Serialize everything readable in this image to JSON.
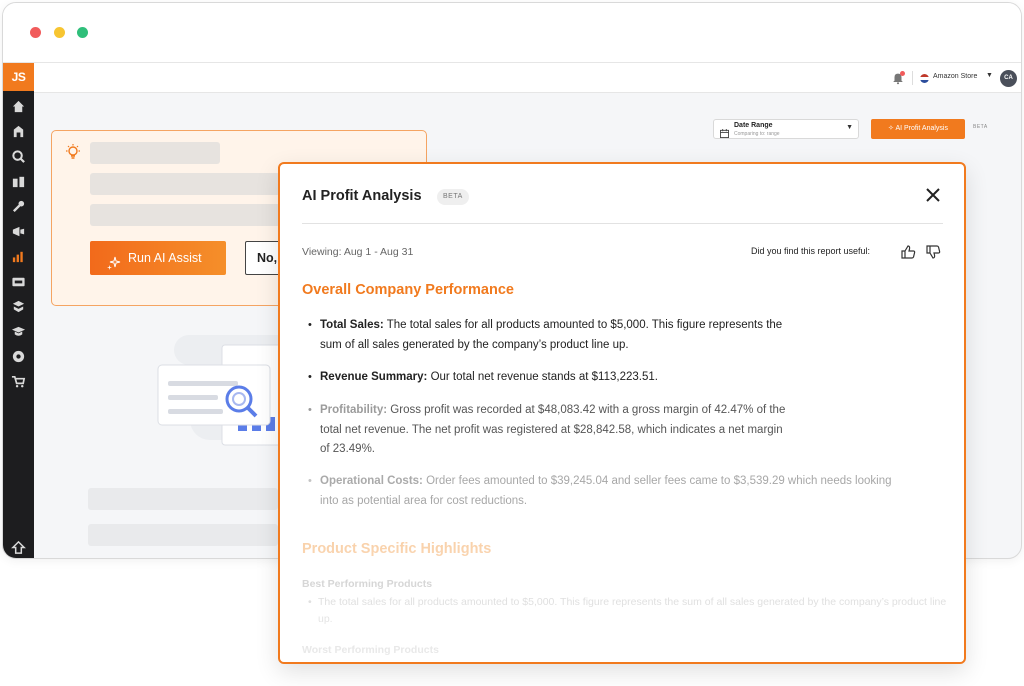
{
  "app": {
    "logo": "JS",
    "store": "Amazon Store",
    "avatar_initials": "CA"
  },
  "toolbar": {
    "date_range_label": "Date Range",
    "date_range_sub": "Comparing to: range",
    "ai_button_label": "AI Profit Analysis",
    "beta_label": "BETA"
  },
  "assist": {
    "run_label": "Run AI Assist",
    "no_label": "No,"
  },
  "modal": {
    "title": "AI Profit Analysis",
    "beta": "BETA",
    "viewing": "Viewing: Aug 1 - Aug 31",
    "feedback_question": "Did you find this report useful:",
    "section1_title": "Overall Company Performance",
    "bullets": [
      {
        "label": "Total Sales:",
        "text": " The total sales for all products amounted to $5,000. This figure represents the sum of all sales generated by the company’s product line up."
      },
      {
        "label": "Revenue Summary:",
        "text": " Our total net revenue stands at $113,223.51."
      },
      {
        "label": "Profitability:",
        "text": " Gross profit was recorded at $48,083.42 with a gross margin of 42.47% of the total net revenue. The net profit was registered at $28,842.58, which indicates a net margin of 23.49%."
      },
      {
        "label": "Operational Costs:",
        "text": " Order fees amounted to $39,245.04 and seller fees came to $3,539.29 which needs looking into as potential area for cost reductions."
      }
    ],
    "section2_title": "Product Specific Highlights",
    "best_title": "Best Performing Products",
    "best_text": "The total sales for all products amounted to $5,000. This figure represents the sum of all sales generated by the company’s product line up.",
    "worst_title": "Worst Performing Products"
  },
  "colors": {
    "accent": "#f17a1e",
    "sidebar": "#1d1d1f"
  }
}
